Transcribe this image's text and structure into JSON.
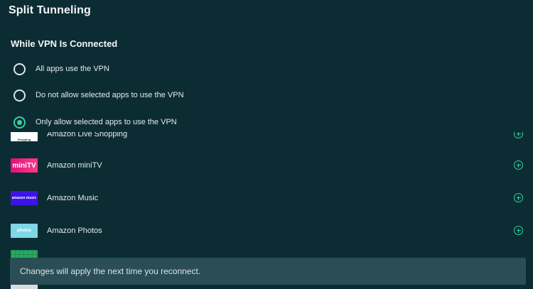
{
  "page": {
    "title": "Split Tunneling"
  },
  "vpn_mode": {
    "heading": "While VPN Is Connected",
    "options": [
      {
        "label": "All apps use the VPN",
        "selected": false
      },
      {
        "label": "Do not allow selected apps to use the VPN",
        "selected": false
      },
      {
        "label": "Only allow selected apps to use the VPN",
        "selected": true
      }
    ]
  },
  "apps": [
    {
      "name": "Amazon Live Shopping",
      "logo_text": "Shopping",
      "icon": "add-circle-icon"
    },
    {
      "name": "Amazon miniTV",
      "logo_text": "miniTV",
      "icon": "add-circle-icon"
    },
    {
      "name": "Amazon Music",
      "logo_text": "amazon music",
      "icon": "add-circle-icon"
    },
    {
      "name": "Amazon Photos",
      "logo_text": "photos",
      "icon": "add-circle-icon"
    },
    {
      "name": "",
      "logo_text": "",
      "icon": ""
    }
  ],
  "toast": {
    "message": "Changes will apply the next time you reconnect."
  },
  "colors": {
    "background": "#0c2c33",
    "accent": "#35d1a0",
    "toast_background": "#2b4d55"
  }
}
